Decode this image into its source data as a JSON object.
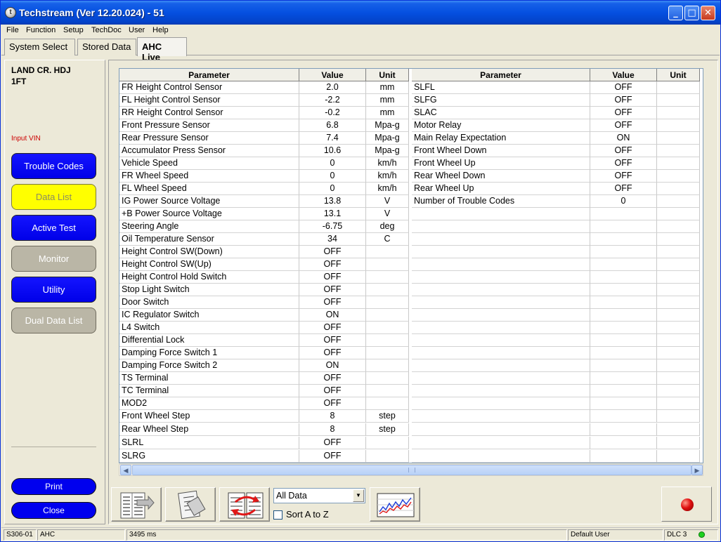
{
  "window": {
    "title": "Techstream (Ver 12.20.024) - 51"
  },
  "icons": {
    "app": "techstream-app-icon",
    "minimize": "minimize-icon",
    "maximize": "maximize-icon",
    "close": "close-icon",
    "scroll_left": "scroll-left-icon",
    "scroll_right": "scroll-right-icon",
    "dropdown": "chevron-down-icon",
    "record": "record-icon"
  },
  "menu": [
    "File",
    "Function",
    "Setup",
    "TechDoc",
    "User",
    "Help"
  ],
  "tabs": [
    {
      "label": "System Select",
      "active": false
    },
    {
      "label": "Stored Data",
      "active": false
    },
    {
      "label": "AHC Live",
      "active": true
    }
  ],
  "sidebar": {
    "vehicle": "LAND CR. HDJ\n1FT",
    "input_vin": "Input VIN",
    "buttons": [
      {
        "label": "Trouble Codes",
        "style": "blue"
      },
      {
        "label": "Data List",
        "style": "yellow"
      },
      {
        "label": "Active Test",
        "style": "blue"
      },
      {
        "label": "Monitor",
        "style": "gray"
      },
      {
        "label": "Utility",
        "style": "blue"
      },
      {
        "label": "Dual Data List",
        "style": "gray"
      }
    ],
    "print_label": "Print",
    "close_label": "Close"
  },
  "table": {
    "headers": [
      "Parameter",
      "Value",
      "Unit"
    ],
    "left_rows": [
      [
        "FR Height Control Sensor",
        "2.0",
        "mm"
      ],
      [
        "FL Height Control Sensor",
        "-2.2",
        "mm"
      ],
      [
        "RR Height Control Sensor",
        "-0.2",
        "mm"
      ],
      [
        "Front Pressure Sensor",
        "6.8",
        "Mpa-g"
      ],
      [
        "Rear Pressure Sensor",
        "7.4",
        "Mpa-g"
      ],
      [
        "Accumulator Press Sensor",
        "10.6",
        "Mpa-g"
      ],
      [
        "Vehicle Speed",
        "0",
        "km/h"
      ],
      [
        "FR Wheel Speed",
        "0",
        "km/h"
      ],
      [
        "FL Wheel Speed",
        "0",
        "km/h"
      ],
      [
        "IG Power Source Voltage",
        "13.8",
        "V"
      ],
      [
        "+B Power Source Voltage",
        "13.1",
        "V"
      ],
      [
        "Steering Angle",
        "-6.75",
        "deg"
      ],
      [
        "Oil Temperature Sensor",
        "34",
        "C"
      ],
      [
        "Height Control SW(Down)",
        "OFF",
        ""
      ],
      [
        "Height Control SW(Up)",
        "OFF",
        ""
      ],
      [
        "Height Control Hold Switch",
        "OFF",
        ""
      ],
      [
        "Stop Light Switch",
        "OFF",
        ""
      ],
      [
        "Door Switch",
        "OFF",
        ""
      ],
      [
        "IC Regulator Switch",
        "ON",
        ""
      ],
      [
        "L4 Switch",
        "OFF",
        ""
      ],
      [
        "Differential Lock",
        "OFF",
        ""
      ],
      [
        "Damping Force Switch 1",
        "OFF",
        ""
      ],
      [
        "Damping Force Switch 2",
        "ON",
        ""
      ],
      [
        "TS Terminal",
        "OFF",
        ""
      ],
      [
        "TC Terminal",
        "OFF",
        ""
      ],
      [
        "MOD2",
        "OFF",
        ""
      ],
      [
        "Front Wheel Step",
        "8",
        "step"
      ],
      [
        "Rear Wheel Step",
        "8",
        "step"
      ],
      [
        "SLRL",
        "OFF",
        ""
      ],
      [
        "SLRG",
        "OFF",
        ""
      ]
    ],
    "right_rows": [
      [
        "SLFL",
        "OFF",
        ""
      ],
      [
        "SLFG",
        "OFF",
        ""
      ],
      [
        "SLAC",
        "OFF",
        ""
      ],
      [
        "Motor Relay",
        "OFF",
        ""
      ],
      [
        "Main Relay Expectation",
        "ON",
        ""
      ],
      [
        "Front Wheel Down",
        "OFF",
        ""
      ],
      [
        "Front Wheel Up",
        "OFF",
        ""
      ],
      [
        "Rear Wheel Down",
        "OFF",
        ""
      ],
      [
        "Rear Wheel Up",
        "OFF",
        ""
      ],
      [
        "Number of Trouble Codes",
        "0",
        ""
      ]
    ]
  },
  "toolbar": {
    "select_value": "All Data",
    "sort_label": "Sort A to Z",
    "sort_checked": false
  },
  "status": {
    "code": "S306-01",
    "system": "AHC",
    "timing": "3495 ms",
    "user": "Default User",
    "dlc": "DLC 3",
    "led_color": "#1fd11f"
  }
}
